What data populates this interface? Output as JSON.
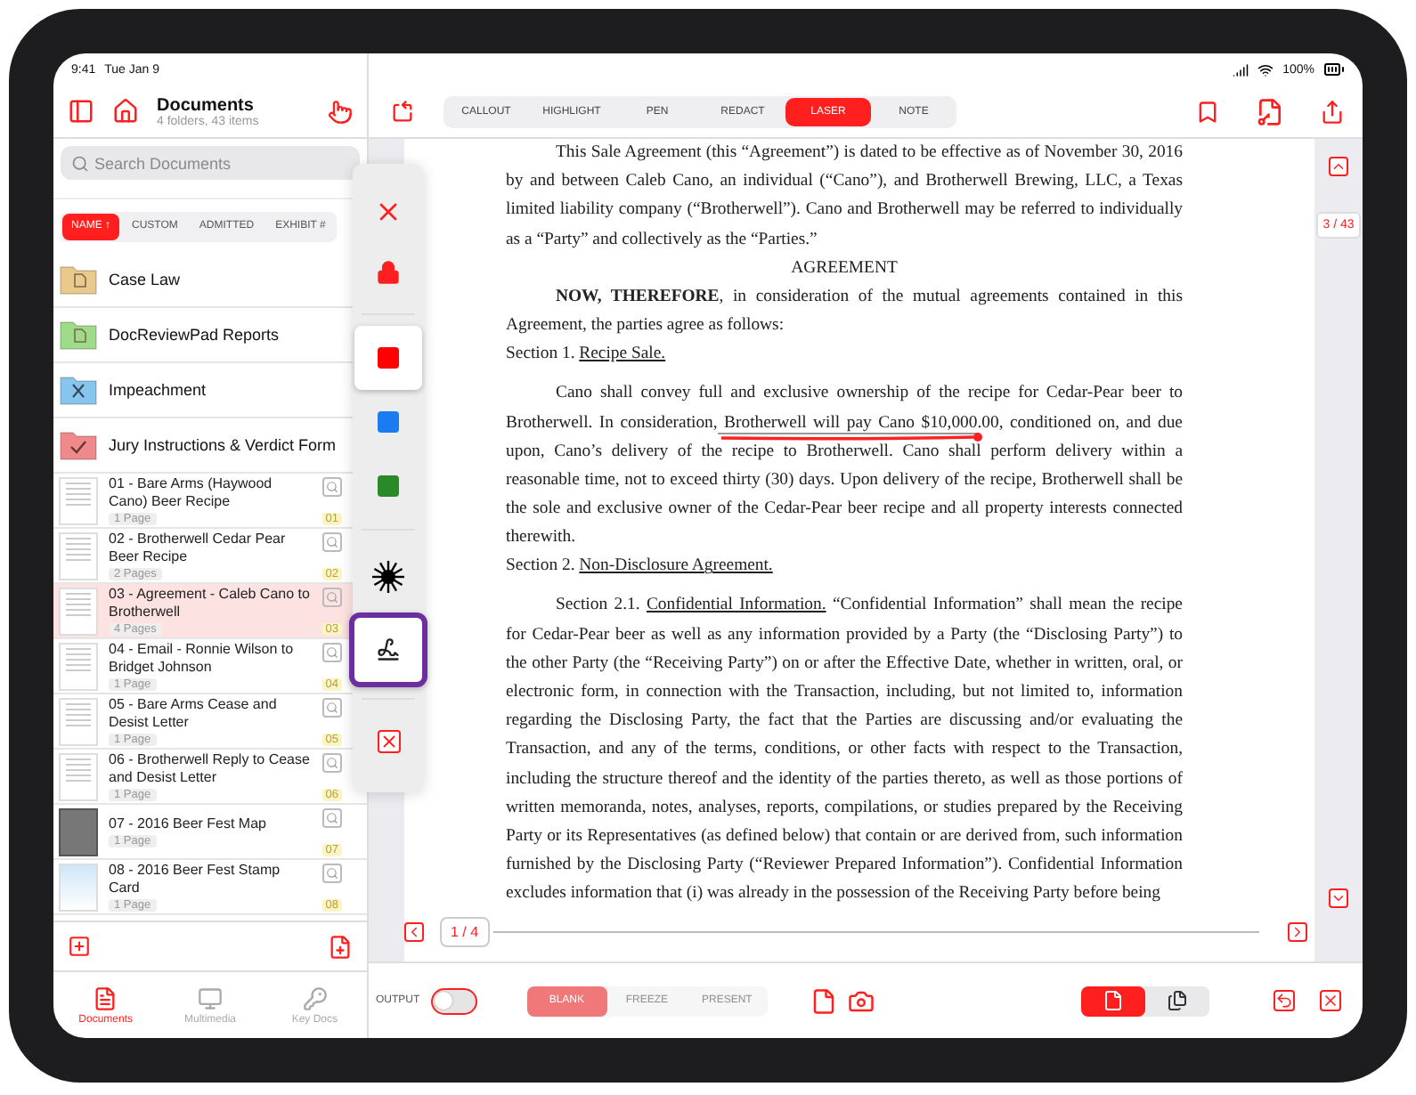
{
  "status_bar": {
    "time": "9:41",
    "date": "Tue Jan 9",
    "battery": "100%"
  },
  "sidebar": {
    "title": "Documents",
    "subtitle": "4 folders, 43 items",
    "search": {
      "placeholder": "Search Documents"
    },
    "sort_tabs": [
      {
        "label": "NAME ↑",
        "selected": true
      },
      {
        "label": "CUSTOM",
        "selected": false
      },
      {
        "label": "ADMITTED",
        "selected": false
      },
      {
        "label": "EXHIBIT #",
        "selected": false
      }
    ],
    "folders": [
      {
        "name": "Case Law",
        "color": "#e9c98c",
        "kind": "document"
      },
      {
        "name": "DocReviewPad Reports",
        "color": "#9fdc8a",
        "kind": "document"
      },
      {
        "name": "Impeachment",
        "color": "#86c6ee",
        "kind": "cross"
      },
      {
        "name": "Jury Instructions & Verdict Form",
        "color": "#f08a8a",
        "kind": "check"
      }
    ],
    "documents": [
      {
        "title": "01 - Bare Arms (Haywood Cano) Beer Recipe",
        "pages": "1 Page",
        "exhibit": "01",
        "selected": false,
        "kind": "document"
      },
      {
        "title": "02 - Brotherwell Cedar Pear Beer Recipe",
        "pages": "2 Pages",
        "exhibit": "02",
        "selected": false,
        "kind": "document"
      },
      {
        "title": "03 - Agreement - Caleb Cano to Brotherwell",
        "pages": "4 Pages",
        "exhibit": "03",
        "selected": true,
        "kind": "document"
      },
      {
        "title": "04 - Email - Ronnie Wilson to Bridget Johnson",
        "pages": "1 Page",
        "exhibit": "04",
        "selected": false,
        "kind": "document"
      },
      {
        "title": "05 - Bare Arms Cease and Desist Letter",
        "pages": "1 Page",
        "exhibit": "05",
        "selected": false,
        "kind": "document"
      },
      {
        "title": "06 - Brotherwell Reply to Cease and Desist Letter",
        "pages": "1 Page",
        "exhibit": "06",
        "selected": false,
        "kind": "document"
      },
      {
        "title": "07 - 2016 Beer Fest Map",
        "pages": "1 Page",
        "exhibit": "07",
        "selected": false,
        "kind": "photo"
      },
      {
        "title": "08 - 2016 Beer Fest Stamp Card",
        "pages": "1 Page",
        "exhibit": "08",
        "selected": false,
        "kind": "card"
      }
    ],
    "tabs": [
      {
        "label": "Documents",
        "selected": true,
        "kind": "document"
      },
      {
        "label": "Multimedia",
        "selected": false,
        "kind": "monitor"
      },
      {
        "label": "Key Docs",
        "selected": false,
        "kind": "key"
      }
    ]
  },
  "toolbar": {
    "modes": [
      {
        "label": "CALLOUT",
        "selected": false
      },
      {
        "label": "HIGHLIGHT",
        "selected": false
      },
      {
        "label": "PEN",
        "selected": false
      },
      {
        "label": "REDACT",
        "selected": false
      },
      {
        "label": "LASER",
        "selected": true
      },
      {
        "label": "NOTE",
        "selected": false
      }
    ]
  },
  "tool_palette": [
    {
      "kind": "close"
    },
    {
      "kind": "lock"
    },
    {
      "kind": "divider"
    },
    {
      "kind": "swatch",
      "color": "#ff0000",
      "selected": true
    },
    {
      "kind": "swatch",
      "color": "#1a7cf0",
      "selected": false
    },
    {
      "kind": "swatch",
      "color": "#2a8a2a",
      "selected": false
    },
    {
      "kind": "divider"
    },
    {
      "kind": "burst",
      "selected": false
    },
    {
      "kind": "pen",
      "selected": true
    },
    {
      "kind": "divider"
    },
    {
      "kind": "delete"
    }
  ],
  "document": {
    "blocks": [
      {
        "kind": "paragraph",
        "lines": [
          "This Sale Agreement (this “Agreement”) is dated to be effective as of November 30, 2016",
          "by and between Caleb Cano, an individual (“Cano”), and Brotherwell Brewing, LLC, a Texas",
          "limited liability company (“Brotherwell”). Cano and Brotherwell may be referred to individually",
          "as a “Party” and collectively as the “Parties.”"
        ]
      },
      {
        "kind": "heading",
        "lines": [
          "AGREEMENT"
        ]
      },
      {
        "kind": "paragraph",
        "lines": [
          "**NOW, THEREFORE**, in consideration of the mutual agreements contained in this",
          "Agreement, the parties agree as follows:"
        ]
      },
      {
        "kind": "section",
        "lines": [
          {
            "parts": [
              {
                "text": "Section 1. ",
                "underline": false
              },
              {
                "text": "Recipe Sale.",
                "underline": true
              }
            ]
          }
        ]
      },
      {
        "kind": "paragraph",
        "lines": [
          "Cano shall convey full and exclusive ownership of the recipe for Cedar-Pear beer to",
          "Brotherwell. In consideration, Brotherwell will pay Cano $10,000.00, conditioned on, and due",
          "upon, Cano’s delivery of the recipe to Brotherwell. Cano shall perform delivery within a",
          "reasonable time, not to exceed thirty (30) days. Upon delivery of the recipe, Brotherwell shall be",
          "the sole and exclusive owner of the Cedar-Pear beer recipe and all property interests connected",
          "therewith."
        ]
      },
      {
        "kind": "section",
        "lines": [
          {
            "parts": [
              {
                "text": "Section 2. ",
                "underline": false
              },
              {
                "text": "Non-Disclosure Agreement.",
                "underline": true
              }
            ]
          }
        ]
      },
      {
        "kind": "paragraph",
        "lines": [
          {
            "parts": [
              {
                "text": "Section 2.1. ",
                "underline": false
              },
              {
                "text": "Confidential Information.",
                "underline": true
              },
              {
                "text": " “Confidential Information” shall mean the recipe",
                "underline": false
              }
            ]
          },
          "for Cedar-Pear beer  as well as any information provided by a Party (the “Disclosing Party”) to",
          "the other Party (the “Receiving Party”) on or after the Effective Date, whether in written, oral, or",
          "electronic form, in connection with the Transaction, including, but not limited to, information",
          "regarding the Disclosing Party, the fact that the Parties are discussing and/or evaluating the",
          "Transaction, and any of the terms, conditions, or other facts with respect to the Transaction,",
          "including the structure thereof and the identity of the parties thereto, as well as those portions of",
          "written memoranda, notes, analyses, reports, compilations, or studies prepared by the Receiving",
          "Party or its Representatives (as defined below) that contain or are derived from, such information",
          "furnished by the Disclosing Party (“Reviewer Prepared Information”). Confidential Information",
          "excludes information that (i) was already in the possession of the Receiving Party before being"
        ]
      }
    ]
  },
  "pager": {
    "page": "1 / 4"
  },
  "page_counter": "3 / 43",
  "bottom_bar": {
    "output_label": "OUTPUT",
    "output_on": false,
    "modes": [
      {
        "label": "BLANK",
        "selected": true
      },
      {
        "label": "FREEZE",
        "selected": false
      },
      {
        "label": "PRESENT",
        "selected": false
      }
    ],
    "modes_disabled": true,
    "layouts": [
      {
        "kind": "single",
        "selected": true
      },
      {
        "kind": "double",
        "selected": false
      }
    ]
  }
}
